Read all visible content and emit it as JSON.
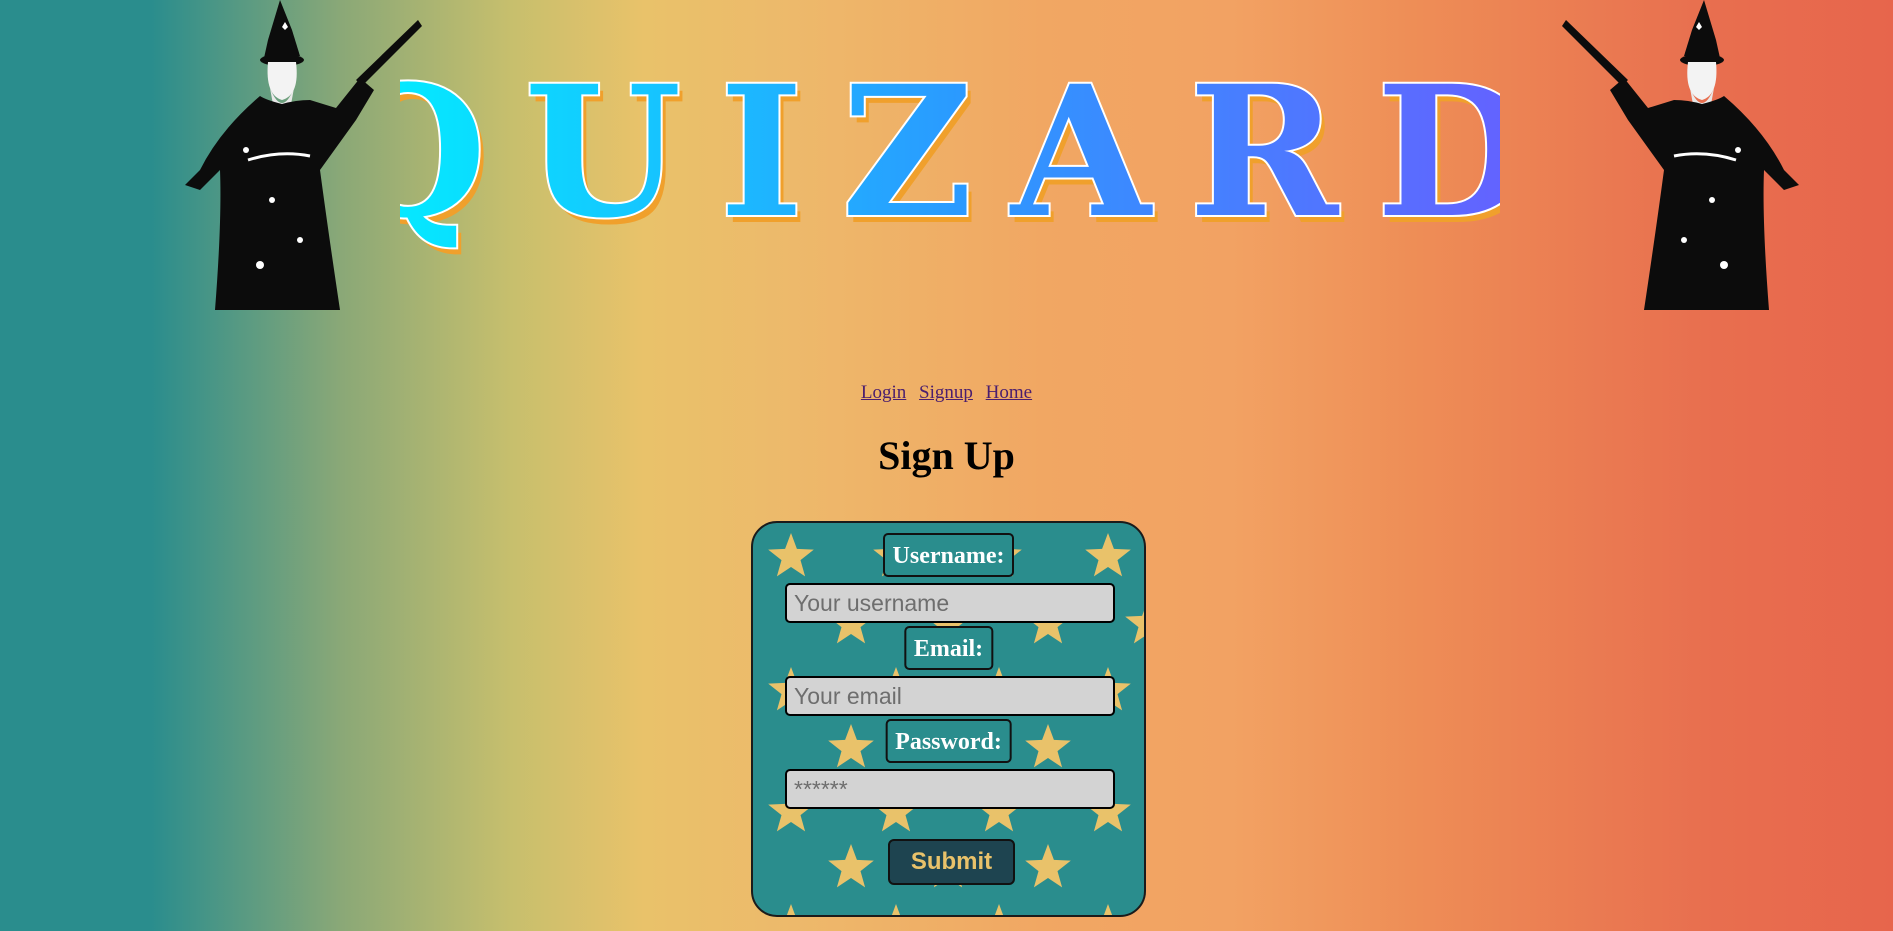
{
  "banner": {
    "logo_text": "QUIZARD",
    "wizard_icon": "wizard-icon",
    "colors": {
      "logo_start": "#00f2ff",
      "logo_end": "#6a5cff",
      "logo_shadow": "#f0a02c",
      "wizard": "#0c0c0c"
    }
  },
  "nav": {
    "links": [
      {
        "label": "Login"
      },
      {
        "label": "Signup"
      },
      {
        "label": "Home"
      }
    ]
  },
  "page": {
    "heading": "Sign Up"
  },
  "form": {
    "username_label": "Username:",
    "username_placeholder": "Your username",
    "username_value": "",
    "email_label": "Email:",
    "email_placeholder": "Your email",
    "email_value": "",
    "password_label": "Password:",
    "password_placeholder": "******",
    "password_value": "",
    "submit_label": "Submit",
    "star_icon": "star-icon",
    "colors": {
      "card_bg": "#2a8d8d",
      "star": "#e9c26a",
      "input_bg": "#d3d3d3",
      "button_bg": "#1e4450",
      "button_text": "#e9c26a"
    }
  }
}
